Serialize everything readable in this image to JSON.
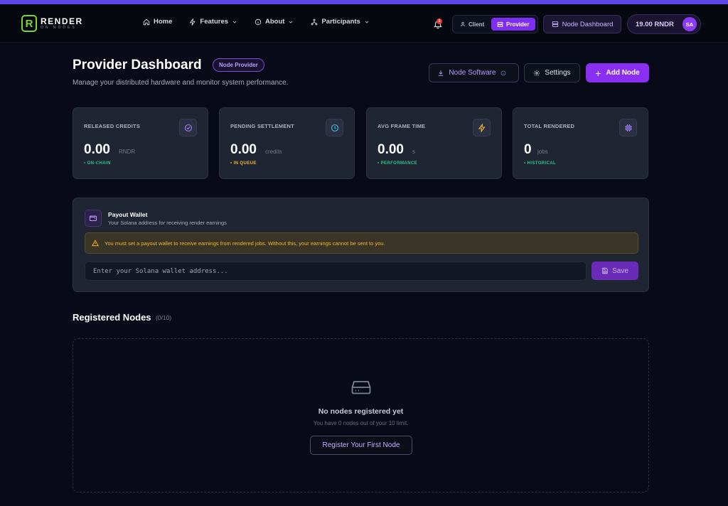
{
  "brand": {
    "name": "RENDER",
    "tagline": "ON NODES",
    "accent_green": "#7ad53a",
    "accent_purple": "#8a2ff2"
  },
  "nav": {
    "items": [
      {
        "label": "Home",
        "icon": "home-icon"
      },
      {
        "label": "Features",
        "icon": "bolt-icon"
      },
      {
        "label": "About",
        "icon": "info-icon"
      },
      {
        "label": "Participants",
        "icon": "network-icon"
      }
    ],
    "notification_count": "1",
    "roles": {
      "client": "Client",
      "provider": "Provider",
      "active": "provider"
    },
    "node_dashboard_label": "Node Dashboard",
    "balance": "19.00 RNDR",
    "avatar_initials": "SA"
  },
  "header": {
    "title": "Provider Dashboard",
    "badge": "Node Provider",
    "subtitle": "Manage your distributed hardware and monitor system performance.",
    "node_software_label": "Node Software",
    "settings_label": "Settings",
    "add_node_label": "Add Node"
  },
  "stats": [
    {
      "label": "RELEASED CREDITS",
      "value": "0.00",
      "unit": "RNDR",
      "tag": "• ON-CHAIN",
      "tag_color": "#22c587",
      "icon": "check-circle-icon",
      "icon_color": "#a37cff"
    },
    {
      "label": "PENDING SETTLEMENT",
      "value": "0.00",
      "unit": "credits",
      "tag": "• IN QUEUE",
      "tag_color": "#f0b92b",
      "icon": "clock-icon",
      "icon_color": "#3cc3e8"
    },
    {
      "label": "AVG FRAME TIME",
      "value": "0.00",
      "unit": "s",
      "tag": "• PERFORMANCE",
      "tag_color": "#22c587",
      "icon": "bolt-icon",
      "icon_color": "#f0b92b"
    },
    {
      "label": "TOTAL RENDERED",
      "value": "0",
      "unit": "jobs",
      "tag": "• HISTORICAL",
      "tag_color": "#22c587",
      "icon": "cpu-icon",
      "icon_color": "#a37cff"
    }
  ],
  "wallet": {
    "title": "Payout Wallet",
    "subtitle": "Your Solana address for receiving render earnings",
    "warning": "You must set a payout wallet to receive earnings from rendered jobs. Without this, your earnings cannot be sent to you.",
    "placeholder": "Enter your Solana wallet address...",
    "value": "",
    "save_label": "Save"
  },
  "nodes": {
    "title": "Registered Nodes",
    "count": "(0/10)",
    "empty_title": "No nodes registered yet",
    "empty_subtitle": "You have 0 nodes out of your 10 limit.",
    "register_label": "Register Your First Node"
  }
}
